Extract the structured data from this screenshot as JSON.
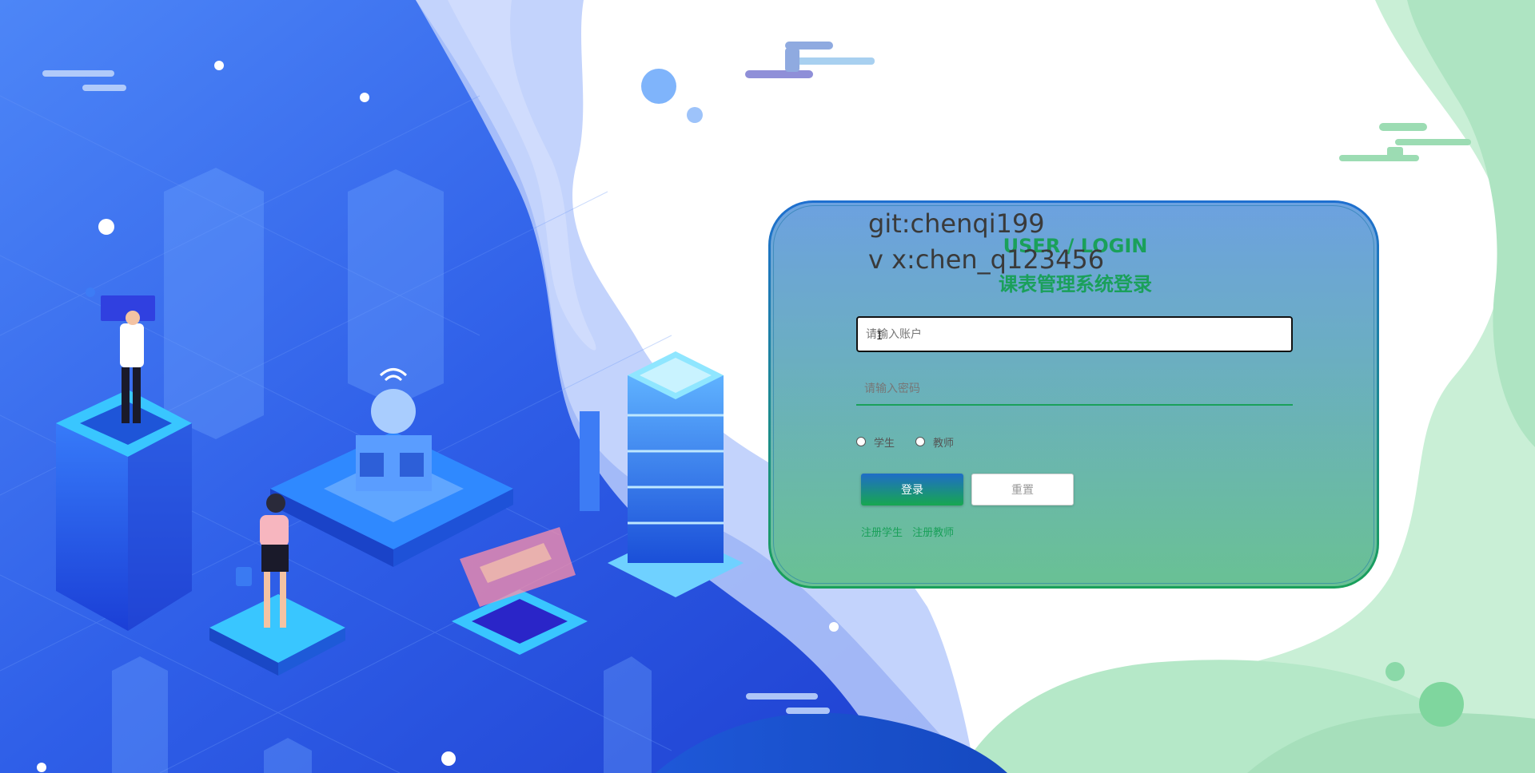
{
  "watermark": {
    "line1": "git:chenqi199",
    "line2": "v x:chen_q123456"
  },
  "login": {
    "title_en": "USER / LOGIN",
    "title_cn": "课表管理系统登录",
    "account_placeholder": "请输入账户",
    "password_placeholder": "请输入密码",
    "roles": [
      {
        "label": "学生"
      },
      {
        "label": "教师"
      }
    ],
    "login_button": "登录",
    "reset_button": "重置",
    "register_student": "注册学生",
    "register_teacher": "注册教师"
  },
  "colors": {
    "accent_green": "#1aa05a",
    "accent_blue": "#1f6dc7",
    "left_panel_blue": "#2f5fe8",
    "right_panel_green": "#a8e2bd"
  },
  "illustration": {
    "left": "isometric-data-center-illustration",
    "right": "green-wave-decoration"
  },
  "cursor": {
    "glyph": "I"
  }
}
